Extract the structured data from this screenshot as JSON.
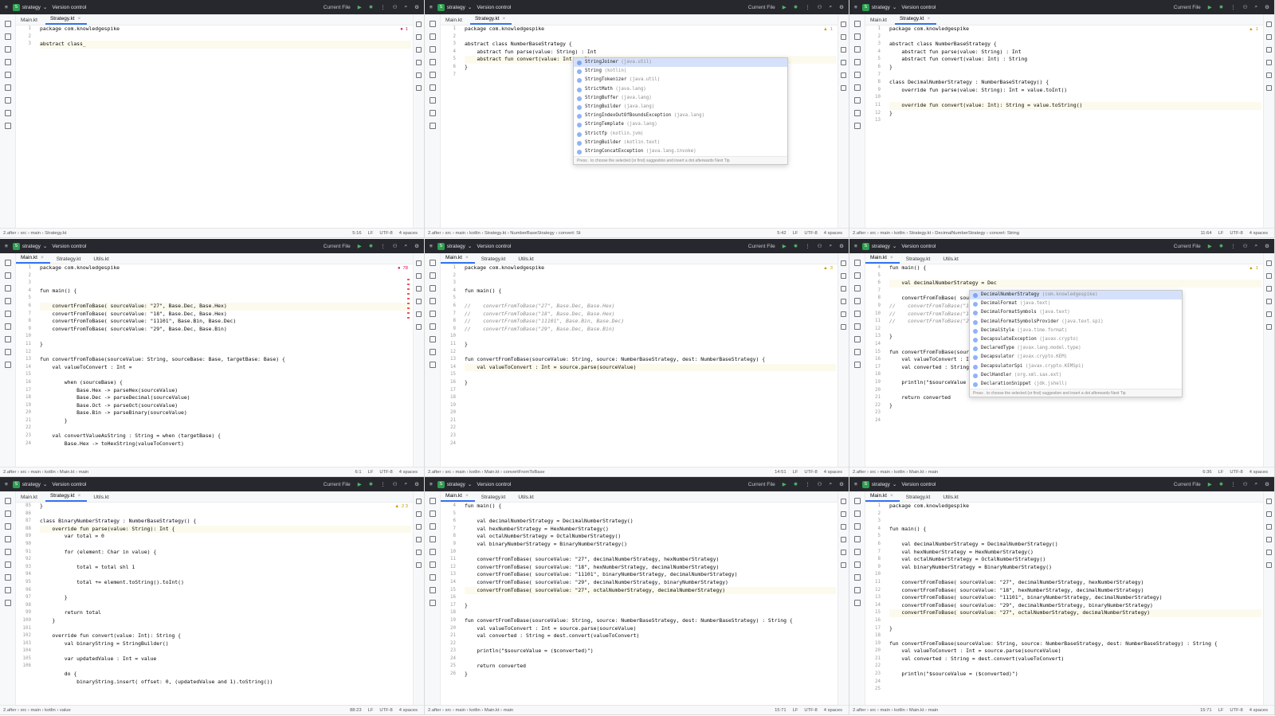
{
  "project": "strategy",
  "vcs": "Version control",
  "run_config": "Current File",
  "panes": [
    {
      "tabs": [
        "Main.kt",
        "Strategy.kt"
      ],
      "active_tab": 1,
      "lines": [
        "1",
        "2",
        "3"
      ],
      "code": [
        "package com.knowledgespike",
        "",
        "abstract class_"
      ],
      "warnings": "1",
      "status_crumb": "2.after › src › main › Strategy.kt",
      "status_pos": "5:16",
      "status_info": [
        "LF",
        "UTF-8",
        "4 spaces"
      ]
    },
    {
      "tabs": [
        "Main.kt",
        "Strategy.kt"
      ],
      "active_tab": 1,
      "lines": [
        "1",
        "2",
        "3",
        "4",
        "5",
        "6",
        "7"
      ],
      "code": [
        "package com.knowledgespike",
        "",
        "abstract class NumberBaseStrategy {",
        "    abstract fun parse(value: String) : Int",
        "    abstract fun convert(value: Int) : Str",
        "}",
        ""
      ],
      "warnings": "1",
      "popup_items": [
        {
          "name": "StringJoiner",
          "pkg": "(java.util)"
        },
        {
          "name": "String",
          "pkg": "(kotlin)"
        },
        {
          "name": "StringTokenizer",
          "pkg": "(java.util)"
        },
        {
          "name": "StrictMath",
          "pkg": "(java.lang)"
        },
        {
          "name": "StringBuffer",
          "pkg": "(java.lang)"
        },
        {
          "name": "StringBuilder",
          "pkg": "(java.lang)"
        },
        {
          "name": "StringIndexOutOfBoundsException",
          "pkg": "(java.lang)"
        },
        {
          "name": "StringTemplate",
          "pkg": "(java.lang)"
        },
        {
          "name": "Strictfp",
          "pkg": "(kotlin.jvm)"
        },
        {
          "name": "StringBuilder",
          "pkg": "(kotlin.text)"
        },
        {
          "name": "StringConcatException",
          "pkg": "(java.lang.invoke)"
        }
      ],
      "popup_footer": "Press . to choose the selected (or first) suggestion and insert a dot afterwards  Next Tip",
      "status_crumb": "2.after › src › main › kotlin › Strategy.kt › NumberBaseStrategy › convert: St",
      "status_pos": "5:42",
      "status_info": [
        "LF",
        "UTF-8",
        "4 spaces"
      ]
    },
    {
      "tabs": [
        "Main.kt",
        "Strategy.kt"
      ],
      "active_tab": 1,
      "lines": [
        "1",
        "2",
        "3",
        "4",
        "5",
        "6",
        "7",
        "8",
        "9",
        "10",
        "11",
        "12",
        "13"
      ],
      "code": [
        "package com.knowledgespike",
        "",
        "abstract class NumberBaseStrategy {",
        "    abstract fun parse(value: String) : Int",
        "    abstract fun convert(value: Int) : String",
        "}",
        "",
        "class DecimalNumberStrategy : NumberBaseStrategy() {",
        "    override fun parse(value: String): Int = value.toInt()",
        "",
        "    override fun convert(value: Int): String = value.toString()",
        "}",
        ""
      ],
      "warnings": "1",
      "status_crumb": "2.after › src › main › kotlin › Strategy.kt › DecimalNumberStrategy › convert: String",
      "status_pos": "11:64",
      "status_info": [
        "LF",
        "UTF-8",
        "4 spaces"
      ]
    },
    {
      "tabs": [
        "Main.kt",
        "Strategy.kt",
        "Utils.kt"
      ],
      "active_tab": 0,
      "lines": [
        "1",
        "2",
        "3",
        "4",
        "5",
        "6",
        "7",
        "8",
        "9",
        "10",
        "11",
        "12",
        "13",
        "14",
        "15",
        "16",
        "17",
        "18",
        "19",
        "20",
        "21",
        "22",
        "23",
        "24"
      ],
      "code": [
        "package com.knowledgespike",
        "",
        "",
        "fun main() {",
        "",
        "    convertFromToBase( sourceValue: \"27\", Base.Dec, Base.Hex)",
        "    convertFromToBase( sourceValue: \"18\", Base.Dec, Base.Hex)",
        "    convertFromToBase( sourceValue: \"11101\", Base.Bin, Base.Dec)",
        "    convertFromToBase( sourceValue: \"29\", Base.Dec, Base.Bin)",
        "",
        "}",
        "",
        "fun convertFromToBase(sourceValue: String, sourceBase: Base, targetBase: Base) {",
        "    val valueToConvert : Int =",
        "",
        "        when (sourceBase) {",
        "            Base.Hex -> parseHex(sourceValue)",
        "            Base.Dec -> parseDecimal(sourceValue)",
        "            Base.Oct -> parseOct(sourceValue)",
        "            Base.Bin -> parseBinary(sourceValue)",
        "        }",
        "",
        "    val convertValueAsString : String = when (targetBase) {",
        "        Base.Hex -> toHexString(valueToConvert)"
      ],
      "warnings": "78",
      "status_crumb": "2.after › src › main › kotlin › Main.kt › main",
      "status_pos": "6:1",
      "status_info": [
        "LF",
        "UTF-8",
        "4 spaces"
      ]
    },
    {
      "tabs": [
        "Main.kt",
        "Strategy.kt",
        "Utils.kt"
      ],
      "active_tab": 0,
      "lines": [
        "1",
        "2",
        "3",
        "4",
        "5",
        "6",
        "7",
        "8",
        "9",
        "10",
        "11",
        "12",
        "13",
        "14",
        "15",
        "16",
        "17",
        "18",
        "19",
        "20",
        "21",
        "22",
        "23",
        "24"
      ],
      "code": [
        "package com.knowledgespike",
        "",
        "",
        "fun main() {",
        "",
        "//    convertFromToBase(\"27\", Base.Dec, Base.Hex)",
        "//    convertFromToBase(\"18\", Base.Dec, Base.Hex)",
        "//    convertFromToBase(\"11101\", Base.Bin, Base.Dec)",
        "//    convertFromToBase(\"29\", Base.Dec, Base.Bin)",
        "",
        "}",
        "",
        "fun convertFromToBase(sourceValue: String, source: NumberBaseStrategy, dest: NumberBaseStrategy) {",
        "    val valueToConvert : Int = source.parse(sourceValue)",
        "",
        "}",
        "",
        "",
        "",
        "",
        "",
        "",
        "",
        ""
      ],
      "warnings": "3",
      "status_crumb": "2.after › src › main › kotlin › Main.kt › convertFromToBase",
      "status_pos": "14:51",
      "status_info": [
        "LF",
        "UTF-8",
        "4 spaces"
      ]
    },
    {
      "tabs": [
        "Main.kt",
        "Strategy.kt",
        "Utils.kt"
      ],
      "active_tab": 0,
      "lines": [
        "4",
        "5",
        "6",
        "7",
        "8",
        "9",
        "10",
        "11",
        "12",
        "13",
        "14",
        "15",
        "16",
        "17",
        "18",
        "19",
        "20",
        "21",
        "22",
        "23",
        "24"
      ],
      "code": [
        "fun main() {",
        "",
        "    val decimalNumberStrategy = Dec",
        "",
        "    convertFromToBase( sour",
        "//    convertFromToBase(\"18",
        "//    convertFromToBase(\"111",
        "//    convertFromToBase(\"29",
        "",
        "}",
        "",
        "fun convertFromToBase(source",
        "    val valueToConvert : Int =",
        "    val converted : String = d",
        "",
        "    println(\"$sourceValue = ",
        "",
        "    return converted",
        "}",
        "",
        ""
      ],
      "warnings": "1",
      "popup_items": [
        {
          "name": "DecimalNumberStrategy",
          "pkg": "(com.knowledgespike)"
        },
        {
          "name": "DecimalFormat",
          "pkg": "(java.text)"
        },
        {
          "name": "DecimalFormatSymbols",
          "pkg": "(java.text)"
        },
        {
          "name": "DecimalFormatSymbolsProvider",
          "pkg": "(java.text.spi)"
        },
        {
          "name": "DecimalStyle",
          "pkg": "(java.time.format)"
        },
        {
          "name": "DecapsulateException",
          "pkg": "(javax.crypto)"
        },
        {
          "name": "DeclaredType",
          "pkg": "(javax.lang.model.type)"
        },
        {
          "name": "Decapsulator",
          "pkg": "(javax.crypto.KEM)"
        },
        {
          "name": "DecapsulatorSpi",
          "pkg": "(javax.crypto.KEMSpi)"
        },
        {
          "name": "DeclHandler",
          "pkg": "(org.xml.sax.ext)"
        },
        {
          "name": "DeclarationSnippet",
          "pkg": "(jdk.jshell)"
        }
      ],
      "popup_footer": "Press . to choose the selected (or first) suggestion and insert a dot afterwards  Next Tip",
      "status_crumb": "2.after › src › main › kotlin › Main.kt › main",
      "status_pos": "6:36",
      "status_info": [
        "LF",
        "UTF-8",
        "4 spaces"
      ]
    },
    {
      "tabs": [
        "Main.kt",
        "Strategy.kt",
        "Utils.kt"
      ],
      "active_tab": 1,
      "lines": [
        "85",
        "86",
        "87",
        "88",
        "89",
        "90",
        "91",
        "92",
        "93",
        "94",
        "95",
        "96",
        "97",
        "98",
        "99",
        "100",
        "101",
        "102",
        "103",
        "104",
        "105",
        "106"
      ],
      "code": [
        "}",
        "",
        "class BinaryNumberStrategy : NumberBaseStrategy() {",
        "    override fun parse(value: String): Int {",
        "        var total = 0",
        "",
        "        for (element: Char in value) {",
        "",
        "            total = total shl 1",
        "",
        "            total += element.toString().toInt()",
        "",
        "        }",
        "",
        "        return total",
        "    }",
        "",
        "    override fun convert(value: Int): String {",
        "        val binaryString = StringBuilder()",
        "",
        "        var updatedValue : Int = value",
        "",
        "        do {",
        "            binaryString.insert( offset: 0, (updatedValue and 1).toString())"
      ],
      "warnings": "2  3",
      "status_crumb": "2.after › src › main › kotlin › value",
      "status_pos": "88:23",
      "status_info": [
        "LF",
        "UTF-8",
        "4 spaces"
      ]
    },
    {
      "tabs": [
        "Main.kt",
        "Strategy.kt",
        "Utils.kt"
      ],
      "active_tab": 0,
      "lines": [
        "4",
        "5",
        "6",
        "7",
        "8",
        "9",
        "10",
        "11",
        "12",
        "13",
        "14",
        "15",
        "16",
        "17",
        "18",
        "19",
        "20",
        "21",
        "22",
        "23",
        "24",
        "25",
        "26"
      ],
      "code": [
        "fun main() {",
        "",
        "    val decimalNumberStrategy = DecimalNumberStrategy()",
        "    val hexNumberStrategy = HexNumberStrategy()",
        "    val octalNumberStrategy = OctalNumberStrategy()",
        "    val binaryNumberStrategy = BinaryNumberStrategy()",
        "",
        "    convertFromToBase( sourceValue: \"27\", decimalNumberStrategy, hexNumberStrategy)",
        "    convertFromToBase( sourceValue: \"18\", hexNumberStrategy, decimalNumberStrategy)",
        "    convertFromToBase( sourceValue: \"11101\", binaryNumberStrategy, decimalNumberStrategy)",
        "    convertFromToBase( sourceValue: \"29\", decimalNumberStrategy, binaryNumberStrategy)",
        "    convertFromToBase( sourceValue: \"27\", octalNumberStrategy, decimalNumberStrategy)",
        "",
        "}",
        "",
        "fun convertFromToBase(sourceValue: String, source: NumberBaseStrategy, dest: NumberBaseStrategy) : String {",
        "    val valueToConvert : Int = source.parse(sourceValue)",
        "    val converted : String = dest.convert(valueToConvert)",
        "",
        "    println(\"$sourceValue = ($converted)\")",
        "",
        "    return converted",
        "}"
      ],
      "warnings": "",
      "status_crumb": "2.after › src › main › kotlin › Main.kt › main",
      "status_pos": "15:71",
      "status_info": [
        "LF",
        "UTF-8",
        "4 spaces"
      ]
    },
    {
      "tabs": [
        "Main.kt",
        "Strategy.kt",
        "Utils.kt"
      ],
      "active_tab": 0,
      "lines": [
        "1",
        "2",
        "3",
        "4",
        "5",
        "6",
        "7",
        "8",
        "9",
        "10",
        "11",
        "12",
        "13",
        "14",
        "15",
        "16",
        "17",
        "18",
        "19",
        "20",
        "21",
        "22",
        "23",
        "24",
        "25"
      ],
      "code": [
        "package com.knowledgespike",
        "",
        "",
        "fun main() {",
        "",
        "    val decimalNumberStrategy = DecimalNumberStrategy()",
        "    val hexNumberStrategy = HexNumberStrategy()",
        "    val octalNumberStrategy = OctalNumberStrategy()",
        "    val binaryNumberStrategy = BinaryNumberStrategy()",
        "",
        "    convertFromToBase( sourceValue: \"27\", decimalNumberStrategy, hexNumberStrategy)",
        "    convertFromToBase( sourceValue: \"18\", hexNumberStrategy, decimalNumberStrategy)",
        "    convertFromToBase( sourceValue: \"11101\", binaryNumberStrategy, decimalNumberStrategy)",
        "    convertFromToBase( sourceValue: \"29\", decimalNumberStrategy, binaryNumberStrategy)",
        "    convertFromToBase( sourceValue: \"27\", octalNumberStrategy, decimalNumberStrategy)",
        "",
        "}",
        "",
        "fun convertFromToBase(sourceValue: String, source: NumberBaseStrategy, dest: NumberBaseStrategy) : String {",
        "    val valueToConvert : Int = source.parse(sourceValue)",
        "    val converted : String = dest.convert(valueToConvert)",
        "",
        "    println(\"$sourceValue = ($converted)\")",
        "",
        ""
      ],
      "warnings": "",
      "status_crumb": "2.after › src › main › kotlin › Main.kt › main",
      "status_pos": "15:71",
      "status_info": [
        "LF",
        "UTF-8",
        "4 spaces"
      ]
    }
  ],
  "colors": {
    "accent": "#3574f0",
    "header_bg": "#27282e",
    "run_green": "#51b56a",
    "error_red": "#dd3344"
  }
}
